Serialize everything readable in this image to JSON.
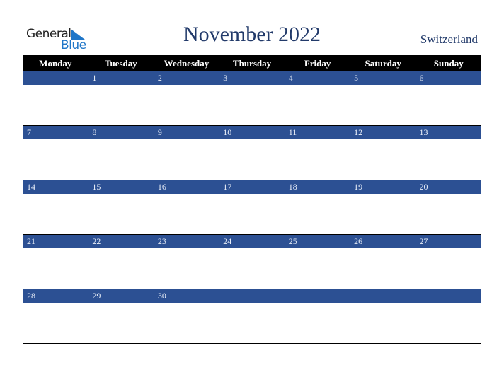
{
  "logo": {
    "line1": "General",
    "line2": "Blue"
  },
  "header": {
    "title": "November 2022",
    "country": "Switzerland"
  },
  "weekdays": [
    "Monday",
    "Tuesday",
    "Wednesday",
    "Thursday",
    "Friday",
    "Saturday",
    "Sunday"
  ],
  "weeks": [
    [
      "",
      "1",
      "2",
      "3",
      "4",
      "5",
      "6"
    ],
    [
      "7",
      "8",
      "9",
      "10",
      "11",
      "12",
      "13"
    ],
    [
      "14",
      "15",
      "16",
      "17",
      "18",
      "19",
      "20"
    ],
    [
      "21",
      "22",
      "23",
      "24",
      "25",
      "26",
      "27"
    ],
    [
      "28",
      "29",
      "30",
      "",
      "",
      "",
      ""
    ]
  ],
  "colors": {
    "accent": "#2c5093",
    "header_bg": "#000000",
    "title": "#223a6a",
    "logo_blue": "#1f76c8"
  }
}
